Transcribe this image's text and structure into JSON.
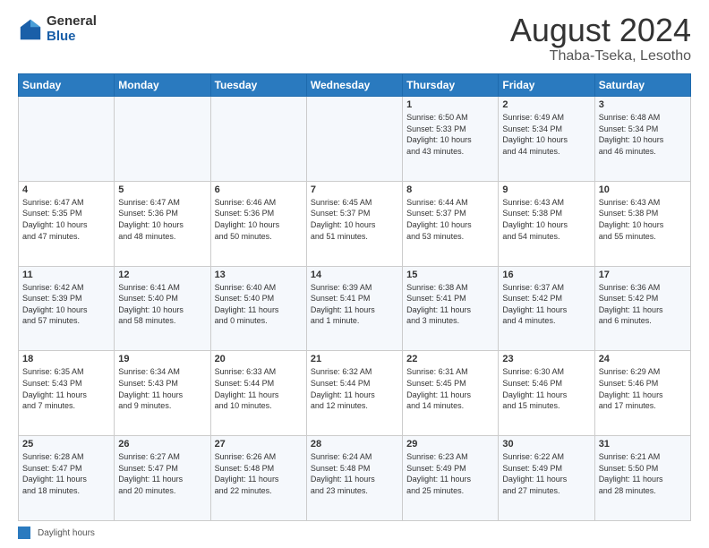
{
  "logo": {
    "general": "General",
    "blue": "Blue"
  },
  "title": "August 2024",
  "location": "Thaba-Tseka, Lesotho",
  "days_header": [
    "Sunday",
    "Monday",
    "Tuesday",
    "Wednesday",
    "Thursday",
    "Friday",
    "Saturday"
  ],
  "weeks": [
    [
      {
        "num": "",
        "info": ""
      },
      {
        "num": "",
        "info": ""
      },
      {
        "num": "",
        "info": ""
      },
      {
        "num": "",
        "info": ""
      },
      {
        "num": "1",
        "info": "Sunrise: 6:50 AM\nSunset: 5:33 PM\nDaylight: 10 hours\nand 43 minutes."
      },
      {
        "num": "2",
        "info": "Sunrise: 6:49 AM\nSunset: 5:34 PM\nDaylight: 10 hours\nand 44 minutes."
      },
      {
        "num": "3",
        "info": "Sunrise: 6:48 AM\nSunset: 5:34 PM\nDaylight: 10 hours\nand 46 minutes."
      }
    ],
    [
      {
        "num": "4",
        "info": "Sunrise: 6:47 AM\nSunset: 5:35 PM\nDaylight: 10 hours\nand 47 minutes."
      },
      {
        "num": "5",
        "info": "Sunrise: 6:47 AM\nSunset: 5:36 PM\nDaylight: 10 hours\nand 48 minutes."
      },
      {
        "num": "6",
        "info": "Sunrise: 6:46 AM\nSunset: 5:36 PM\nDaylight: 10 hours\nand 50 minutes."
      },
      {
        "num": "7",
        "info": "Sunrise: 6:45 AM\nSunset: 5:37 PM\nDaylight: 10 hours\nand 51 minutes."
      },
      {
        "num": "8",
        "info": "Sunrise: 6:44 AM\nSunset: 5:37 PM\nDaylight: 10 hours\nand 53 minutes."
      },
      {
        "num": "9",
        "info": "Sunrise: 6:43 AM\nSunset: 5:38 PM\nDaylight: 10 hours\nand 54 minutes."
      },
      {
        "num": "10",
        "info": "Sunrise: 6:43 AM\nSunset: 5:38 PM\nDaylight: 10 hours\nand 55 minutes."
      }
    ],
    [
      {
        "num": "11",
        "info": "Sunrise: 6:42 AM\nSunset: 5:39 PM\nDaylight: 10 hours\nand 57 minutes."
      },
      {
        "num": "12",
        "info": "Sunrise: 6:41 AM\nSunset: 5:40 PM\nDaylight: 10 hours\nand 58 minutes."
      },
      {
        "num": "13",
        "info": "Sunrise: 6:40 AM\nSunset: 5:40 PM\nDaylight: 11 hours\nand 0 minutes."
      },
      {
        "num": "14",
        "info": "Sunrise: 6:39 AM\nSunset: 5:41 PM\nDaylight: 11 hours\nand 1 minute."
      },
      {
        "num": "15",
        "info": "Sunrise: 6:38 AM\nSunset: 5:41 PM\nDaylight: 11 hours\nand 3 minutes."
      },
      {
        "num": "16",
        "info": "Sunrise: 6:37 AM\nSunset: 5:42 PM\nDaylight: 11 hours\nand 4 minutes."
      },
      {
        "num": "17",
        "info": "Sunrise: 6:36 AM\nSunset: 5:42 PM\nDaylight: 11 hours\nand 6 minutes."
      }
    ],
    [
      {
        "num": "18",
        "info": "Sunrise: 6:35 AM\nSunset: 5:43 PM\nDaylight: 11 hours\nand 7 minutes."
      },
      {
        "num": "19",
        "info": "Sunrise: 6:34 AM\nSunset: 5:43 PM\nDaylight: 11 hours\nand 9 minutes."
      },
      {
        "num": "20",
        "info": "Sunrise: 6:33 AM\nSunset: 5:44 PM\nDaylight: 11 hours\nand 10 minutes."
      },
      {
        "num": "21",
        "info": "Sunrise: 6:32 AM\nSunset: 5:44 PM\nDaylight: 11 hours\nand 12 minutes."
      },
      {
        "num": "22",
        "info": "Sunrise: 6:31 AM\nSunset: 5:45 PM\nDaylight: 11 hours\nand 14 minutes."
      },
      {
        "num": "23",
        "info": "Sunrise: 6:30 AM\nSunset: 5:46 PM\nDaylight: 11 hours\nand 15 minutes."
      },
      {
        "num": "24",
        "info": "Sunrise: 6:29 AM\nSunset: 5:46 PM\nDaylight: 11 hours\nand 17 minutes."
      }
    ],
    [
      {
        "num": "25",
        "info": "Sunrise: 6:28 AM\nSunset: 5:47 PM\nDaylight: 11 hours\nand 18 minutes."
      },
      {
        "num": "26",
        "info": "Sunrise: 6:27 AM\nSunset: 5:47 PM\nDaylight: 11 hours\nand 20 minutes."
      },
      {
        "num": "27",
        "info": "Sunrise: 6:26 AM\nSunset: 5:48 PM\nDaylight: 11 hours\nand 22 minutes."
      },
      {
        "num": "28",
        "info": "Sunrise: 6:24 AM\nSunset: 5:48 PM\nDaylight: 11 hours\nand 23 minutes."
      },
      {
        "num": "29",
        "info": "Sunrise: 6:23 AM\nSunset: 5:49 PM\nDaylight: 11 hours\nand 25 minutes."
      },
      {
        "num": "30",
        "info": "Sunrise: 6:22 AM\nSunset: 5:49 PM\nDaylight: 11 hours\nand 27 minutes."
      },
      {
        "num": "31",
        "info": "Sunrise: 6:21 AM\nSunset: 5:50 PM\nDaylight: 11 hours\nand 28 minutes."
      }
    ]
  ],
  "footer": {
    "legend_label": "Daylight hours"
  }
}
